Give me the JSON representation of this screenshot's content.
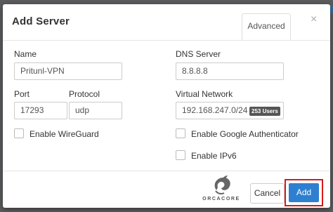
{
  "dialog": {
    "title": "Add Server",
    "advanced_tab": "Advanced",
    "close_symbol": "×"
  },
  "fields": {
    "name": {
      "label": "Name",
      "value": "Pritunl-VPN"
    },
    "dns_server": {
      "label": "DNS Server",
      "value": "8.8.8.8"
    },
    "port": {
      "label": "Port",
      "value": "17293"
    },
    "protocol": {
      "label": "Protocol",
      "value": "udp"
    },
    "virtual_network": {
      "label": "Virtual Network",
      "value": "192.168.247.0/24",
      "badge": "253 Users"
    }
  },
  "checkboxes": {
    "wireguard": {
      "label": "Enable WireGuard",
      "checked": false
    },
    "google_auth": {
      "label": "Enable Google Authenticator",
      "checked": false
    },
    "ipv6": {
      "label": "Enable IPv6",
      "checked": false
    }
  },
  "footer": {
    "watermark": "ORCACORE",
    "cancel_label": "Cancel",
    "add_label": "Add"
  },
  "colors": {
    "primary": "#2e7fd0",
    "highlight": "#d71a1a",
    "badge": "#555555"
  },
  "icons": {
    "close": "close-icon",
    "logo": "orcacore-logo-icon"
  }
}
